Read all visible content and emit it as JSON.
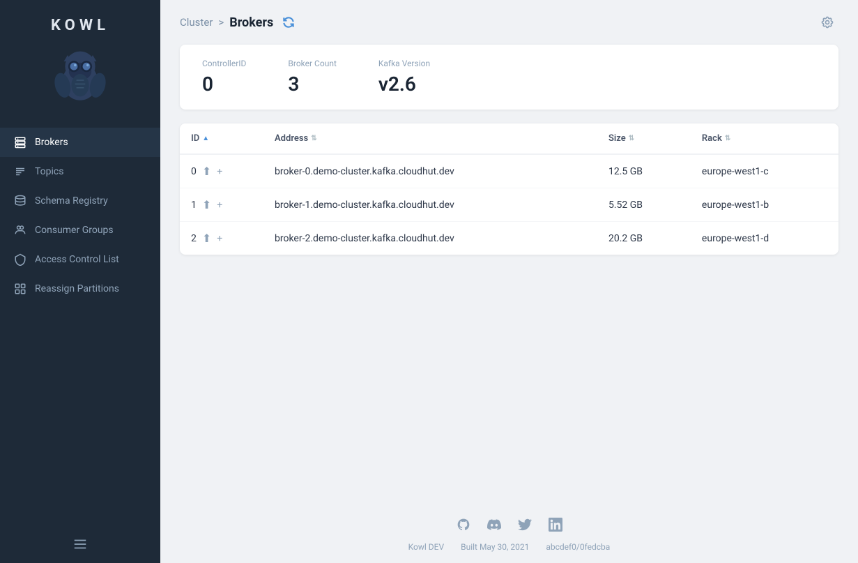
{
  "app": {
    "name": "KOWL",
    "logo_letters": "KOWL"
  },
  "sidebar": {
    "items": [
      {
        "id": "brokers",
        "label": "Brokers",
        "active": true
      },
      {
        "id": "topics",
        "label": "Topics",
        "active": false
      },
      {
        "id": "schema-registry",
        "label": "Schema Registry",
        "active": false
      },
      {
        "id": "consumer-groups",
        "label": "Consumer Groups",
        "active": false
      },
      {
        "id": "access-control-list",
        "label": "Access Control List",
        "active": false
      },
      {
        "id": "reassign-partitions",
        "label": "Reassign Partitions",
        "active": false
      }
    ]
  },
  "breadcrumb": {
    "parent": "Cluster",
    "separator": ">",
    "current": "Brokers"
  },
  "stats": {
    "controller_id_label": "ControllerID",
    "controller_id_value": "0",
    "broker_count_label": "Broker Count",
    "broker_count_value": "3",
    "kafka_version_label": "Kafka Version",
    "kafka_version_value": "v2.6"
  },
  "table": {
    "columns": [
      "ID",
      "Address",
      "Size",
      "Rack"
    ],
    "rows": [
      {
        "id": "0",
        "address": "broker-0.demo-cluster.kafka.cloudhut.dev",
        "size": "12.5 GB",
        "rack": "europe-west1-c"
      },
      {
        "id": "1",
        "address": "broker-1.demo-cluster.kafka.cloudhut.dev",
        "size": "5.52 GB",
        "rack": "europe-west1-b"
      },
      {
        "id": "2",
        "address": "broker-2.demo-cluster.kafka.cloudhut.dev",
        "size": "20.2 GB",
        "rack": "europe-west1-d"
      }
    ]
  },
  "footer": {
    "app_name": "Kowl DEV",
    "build_date": "Built May 30, 2021",
    "commit": "abcdef0/0fedcba",
    "icons": [
      "github",
      "discord",
      "twitter",
      "linkedin"
    ]
  },
  "colors": {
    "accent": "#4a90d9",
    "sidebar_bg": "#1e2a38",
    "sidebar_active": "#253547"
  }
}
